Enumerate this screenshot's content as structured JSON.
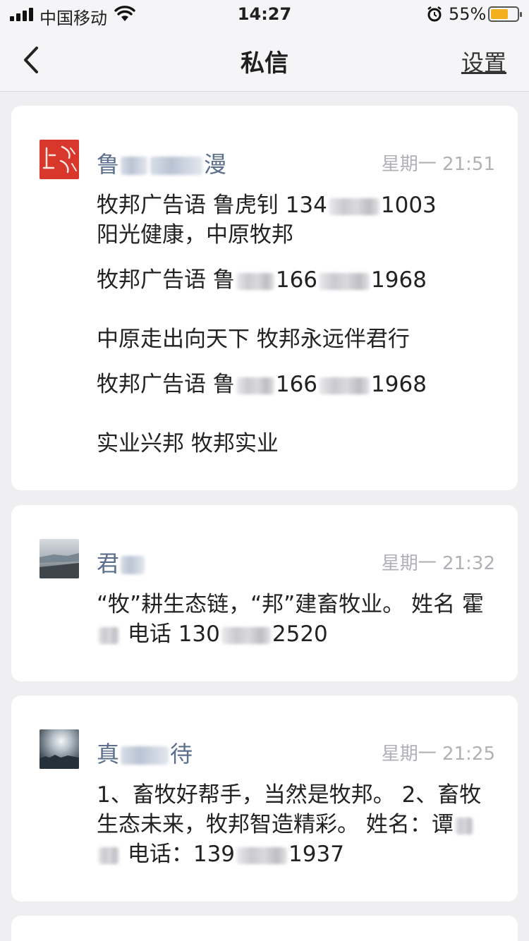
{
  "status_bar": {
    "carrier": "中国移动",
    "time": "14:27",
    "battery": "55%",
    "icons": [
      "signal-icon",
      "wifi-icon",
      "alarm-icon",
      "battery-charging-icon"
    ]
  },
  "nav": {
    "title": "私信",
    "settings_label": "设置",
    "back_icon": "chevron-left-icon"
  },
  "messages": [
    {
      "sender_a": "鲁",
      "sender_b": "漫",
      "time": "星期一 21:51",
      "line1_a": "牧邦广告语 鲁虎钊 134",
      "line1_b": "1003",
      "line2": "阳光健康，中原牧邦",
      "line3_a": "牧邦广告语 鲁",
      "line3_b": "166",
      "line3_c": "1968",
      "line4": "中原走出向天下  牧邦永远伴君行",
      "line5_a": "牧邦广告语 鲁",
      "line5_b": "166",
      "line5_c": "1968",
      "line6": "实业兴邦  牧邦实业"
    },
    {
      "sender_a": "君",
      "time": "星期一 21:32",
      "line1": "“牧”耕生态链，“邦”建畜牧业。 姓名 霍",
      "line2_a": "电话 130",
      "line2_b": "2520"
    },
    {
      "sender_a": "真",
      "sender_b": "待",
      "time": "星期一 21:25",
      "line1": "1、畜牧好帮手，当然是牧邦。 2、畜牧",
      "line2": "生态未来，牧邦智造精彩。 姓名：谭",
      "line3_a": "电话：139",
      "line3_b": "1937"
    }
  ],
  "colors": {
    "background": "#efeff2",
    "sender_name": "#5b6f8c",
    "timestamp": "#b0b0b6",
    "avatar_seal": "#d9372b"
  }
}
